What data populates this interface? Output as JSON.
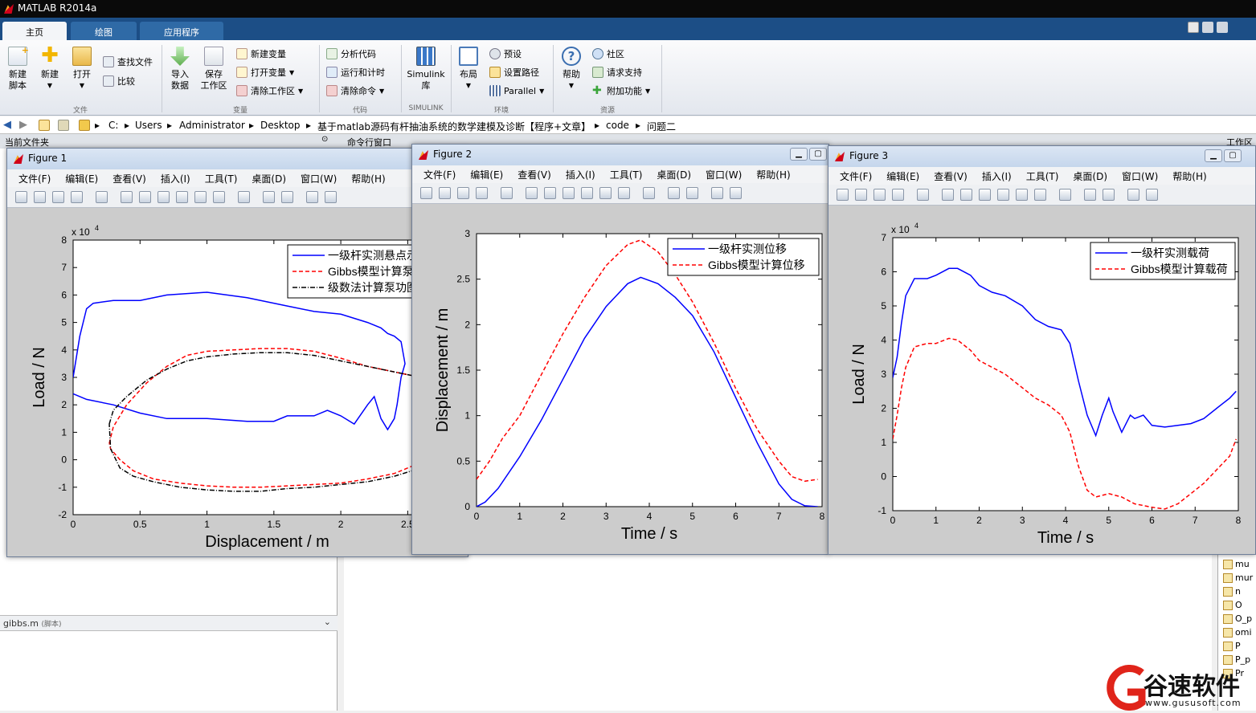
{
  "app": {
    "title": "MATLAB R2014a"
  },
  "tabs": [
    "主页",
    "绘图",
    "应用程序"
  ],
  "ribbon": {
    "big_buttons": [
      {
        "label": "新建\n脚本",
        "icon": "new-script-icon"
      },
      {
        "label": "新建",
        "icon": "new-icon"
      },
      {
        "label": "打开",
        "icon": "open-folder-icon"
      },
      {
        "label": "导入\n数据",
        "icon": "import-data-icon"
      },
      {
        "label": "保存\n工作区",
        "icon": "save-workspace-icon"
      },
      {
        "label": "Simulink\n库",
        "icon": "simulink-icon"
      },
      {
        "label": "布局",
        "icon": "layout-icon"
      },
      {
        "label": "帮助",
        "icon": "help-icon"
      }
    ],
    "small_buttons": {
      "find_files": "查找文件",
      "compare": "比较",
      "new_variable": "新建变量",
      "open_variable": "打开变量",
      "clear_workspace": "清除工作区",
      "analyze_code": "分析代码",
      "run_and_time": "运行和计时",
      "clear_commands": "清除命令",
      "preferences": "预设",
      "set_path": "设置路径",
      "parallel": "Parallel",
      "community": "社区",
      "request_support": "请求支持",
      "add_ons": "附加功能"
    },
    "groups": [
      "文件",
      "变量",
      "代码",
      "SIMULINK",
      "环境",
      "资源"
    ]
  },
  "address": {
    "path": [
      "C:",
      "Users",
      "Administrator",
      "Desktop",
      "基于matlab源码有杆抽油系统的数学建模及诊断【程序+文章】",
      "code",
      "问题二"
    ]
  },
  "panels": {
    "current_folder": "当前文件夹",
    "command_window": "命令行窗口",
    "workspace": "工作区",
    "file_detail": "gibbs.m",
    "file_detail_type": "(脚本)"
  },
  "workspace_items": [
    "mu",
    "mur",
    "n",
    "O",
    "O_p",
    "omi",
    "P",
    "P_p",
    "Pr"
  ],
  "figure_menu": [
    "文件(F)",
    "编辑(E)",
    "查看(V)",
    "插入(I)",
    "工具(T)",
    "桌面(D)",
    "窗口(W)",
    "帮助(H)"
  ],
  "figures": [
    {
      "title": "Figure 1"
    },
    {
      "title": "Figure 2"
    },
    {
      "title": "Figure 3"
    }
  ],
  "chart_data": [
    {
      "type": "line",
      "xlabel": "Displacement / m",
      "ylabel": "Load / N",
      "y_exponent_label": "x 10",
      "y_exponent": "4",
      "xlim": [
        0,
        2.9
      ],
      "ylim": [
        -2,
        8
      ],
      "xticks": [
        "0",
        "0.5",
        "1",
        "1.5",
        "2",
        "2.5"
      ],
      "yticks": [
        "-2",
        "-1",
        "0",
        "1",
        "2",
        "3",
        "4",
        "5",
        "6",
        "7",
        "8"
      ],
      "legend_position": "top-right",
      "series": [
        {
          "name": "一级杆实测悬点示功图",
          "color": "#0000ff",
          "dash": "solid",
          "x": [
            0,
            0.05,
            0.1,
            0.15,
            0.3,
            0.5,
            0.7,
            1.0,
            1.3,
            1.6,
            1.8,
            2.0,
            2.2,
            2.3,
            2.35,
            2.4,
            2.45,
            2.48,
            2.45,
            2.42,
            2.4,
            2.35,
            2.3,
            2.25,
            2.2,
            2.1,
            2.0,
            1.9,
            1.8,
            1.6,
            1.5,
            1.3,
            1.0,
            0.7,
            0.5,
            0.3,
            0.1,
            0
          ],
          "y": [
            3.0,
            4.5,
            5.5,
            5.7,
            5.8,
            5.8,
            6.0,
            6.1,
            5.9,
            5.6,
            5.4,
            5.3,
            5.0,
            4.8,
            4.6,
            4.5,
            4.3,
            3.5,
            3.0,
            2.0,
            1.5,
            1.1,
            1.5,
            2.3,
            2.0,
            1.3,
            1.6,
            1.8,
            1.6,
            1.6,
            1.4,
            1.4,
            1.5,
            1.5,
            1.7,
            2.0,
            2.2,
            2.4
          ]
        },
        {
          "name": "Gibbs模型计算泵功图",
          "color": "#ff0000",
          "dash": "5,3",
          "x": [
            0.27,
            0.3,
            0.4,
            0.55,
            0.7,
            0.85,
            1.0,
            1.2,
            1.4,
            1.6,
            1.8,
            2.0,
            2.2,
            2.4,
            2.6,
            2.75,
            2.9,
            2.85,
            2.75,
            2.6,
            2.4,
            2.2,
            2.0,
            1.8,
            1.6,
            1.4,
            1.2,
            1.0,
            0.8,
            0.6,
            0.45,
            0.35,
            0.28,
            0.27
          ],
          "y": [
            0.6,
            1.2,
            2.0,
            2.8,
            3.4,
            3.8,
            3.95,
            4.0,
            4.05,
            4.05,
            3.95,
            3.7,
            3.4,
            3.2,
            3.0,
            2.7,
            1.6,
            1.0,
            0.4,
            -0.1,
            -0.5,
            -0.7,
            -0.85,
            -0.9,
            -0.95,
            -1.0,
            -1.0,
            -0.95,
            -0.85,
            -0.7,
            -0.4,
            0.0,
            0.4,
            0.6
          ]
        },
        {
          "name": "级数法计算泵功图",
          "color": "#000000",
          "dash": "6,2,1,2",
          "x": [
            0.27,
            0.3,
            0.4,
            0.55,
            0.7,
            0.85,
            1.0,
            1.2,
            1.4,
            1.6,
            1.8,
            2.0,
            2.2,
            2.4,
            2.6,
            2.75,
            2.9,
            2.85,
            2.75,
            2.6,
            2.4,
            2.2,
            2.0,
            1.8,
            1.6,
            1.4,
            1.2,
            1.0,
            0.8,
            0.6,
            0.45,
            0.35,
            0.28,
            0.27
          ],
          "y": [
            1.3,
            1.8,
            2.3,
            2.9,
            3.3,
            3.6,
            3.75,
            3.85,
            3.9,
            3.9,
            3.8,
            3.6,
            3.4,
            3.2,
            3.0,
            2.9,
            2.0,
            1.0,
            0.2,
            -0.3,
            -0.6,
            -0.8,
            -0.9,
            -1.0,
            -1.05,
            -1.15,
            -1.15,
            -1.1,
            -1.0,
            -0.8,
            -0.6,
            -0.3,
            0.4,
            1.3
          ]
        }
      ]
    },
    {
      "type": "line",
      "xlabel": "Time / s",
      "ylabel": "Displacement / m",
      "xlim": [
        0,
        8
      ],
      "ylim": [
        0,
        3
      ],
      "xticks": [
        "0",
        "1",
        "2",
        "3",
        "4",
        "5",
        "6",
        "7",
        "8"
      ],
      "yticks": [
        "0",
        "0.5",
        "1",
        "1.5",
        "2",
        "2.5",
        "3"
      ],
      "legend_position": "top-right",
      "series": [
        {
          "name": "一级杆实测位移",
          "color": "#0000ff",
          "dash": "solid",
          "x": [
            0,
            0.2,
            0.5,
            1.0,
            1.5,
            2.0,
            2.5,
            3.0,
            3.5,
            3.8,
            4.2,
            4.6,
            5.0,
            5.5,
            6.0,
            6.5,
            7.0,
            7.3,
            7.6,
            7.9
          ],
          "y": [
            0,
            0.05,
            0.2,
            0.55,
            0.95,
            1.4,
            1.85,
            2.2,
            2.45,
            2.52,
            2.45,
            2.3,
            2.1,
            1.7,
            1.2,
            0.7,
            0.25,
            0.08,
            0.01,
            0
          ]
        },
        {
          "name": "Gibbs模型计算位移",
          "color": "#ff0000",
          "dash": "5,3",
          "x": [
            0,
            0.3,
            0.6,
            1.0,
            1.5,
            2.0,
            2.5,
            3.0,
            3.5,
            3.8,
            4.2,
            4.6,
            5.0,
            5.5,
            6.0,
            6.5,
            7.0,
            7.3,
            7.6,
            7.9
          ],
          "y": [
            0.3,
            0.5,
            0.75,
            1.0,
            1.45,
            1.9,
            2.3,
            2.65,
            2.88,
            2.93,
            2.8,
            2.55,
            2.25,
            1.8,
            1.3,
            0.85,
            0.5,
            0.33,
            0.28,
            0.3
          ]
        }
      ]
    },
    {
      "type": "line",
      "xlabel": "Time / s",
      "ylabel": "Load / N",
      "y_exponent_label": "x 10",
      "y_exponent": "4",
      "xlim": [
        0,
        8
      ],
      "ylim": [
        -1,
        7
      ],
      "xticks": [
        "0",
        "1",
        "2",
        "3",
        "4",
        "5",
        "6",
        "7",
        "8"
      ],
      "yticks": [
        "-1",
        "0",
        "1",
        "2",
        "3",
        "4",
        "5",
        "6",
        "7"
      ],
      "legend_position": "top-right",
      "series": [
        {
          "name": "一级杆实测载荷",
          "color": "#0000ff",
          "dash": "solid",
          "x": [
            0,
            0.1,
            0.2,
            0.3,
            0.5,
            0.8,
            1.0,
            1.3,
            1.5,
            1.8,
            2.0,
            2.3,
            2.6,
            3.0,
            3.3,
            3.6,
            3.9,
            4.1,
            4.3,
            4.5,
            4.7,
            4.85,
            5.0,
            5.1,
            5.3,
            5.5,
            5.6,
            5.8,
            6.0,
            6.3,
            6.6,
            6.9,
            7.2,
            7.5,
            7.8,
            7.95
          ],
          "y": [
            2.9,
            3.5,
            4.5,
            5.3,
            5.8,
            5.8,
            5.9,
            6.1,
            6.1,
            5.9,
            5.6,
            5.4,
            5.3,
            5.0,
            4.6,
            4.4,
            4.3,
            3.9,
            2.8,
            1.8,
            1.2,
            1.8,
            2.3,
            1.9,
            1.3,
            1.8,
            1.7,
            1.8,
            1.5,
            1.45,
            1.5,
            1.55,
            1.7,
            2.0,
            2.3,
            2.5
          ]
        },
        {
          "name": "Gibbs模型计算载荷",
          "color": "#ff0000",
          "dash": "5,3",
          "x": [
            0,
            0.1,
            0.2,
            0.3,
            0.5,
            0.8,
            1.0,
            1.3,
            1.5,
            1.8,
            2.0,
            2.3,
            2.6,
            3.0,
            3.3,
            3.6,
            3.9,
            4.1,
            4.3,
            4.5,
            4.7,
            4.85,
            5.0,
            5.3,
            5.6,
            5.8,
            6.0,
            6.3,
            6.6,
            6.9,
            7.2,
            7.5,
            7.8,
            7.95
          ],
          "y": [
            1.1,
            1.8,
            2.6,
            3.2,
            3.8,
            3.9,
            3.9,
            4.05,
            4.0,
            3.7,
            3.4,
            3.2,
            3.0,
            2.6,
            2.3,
            2.1,
            1.8,
            1.3,
            0.3,
            -0.4,
            -0.6,
            -0.55,
            -0.5,
            -0.6,
            -0.8,
            -0.85,
            -0.9,
            -0.95,
            -0.8,
            -0.5,
            -0.2,
            0.2,
            0.6,
            1.1
          ]
        }
      ]
    }
  ],
  "watermark": {
    "text": "谷速软件",
    "url": "www.gususoft.com"
  }
}
